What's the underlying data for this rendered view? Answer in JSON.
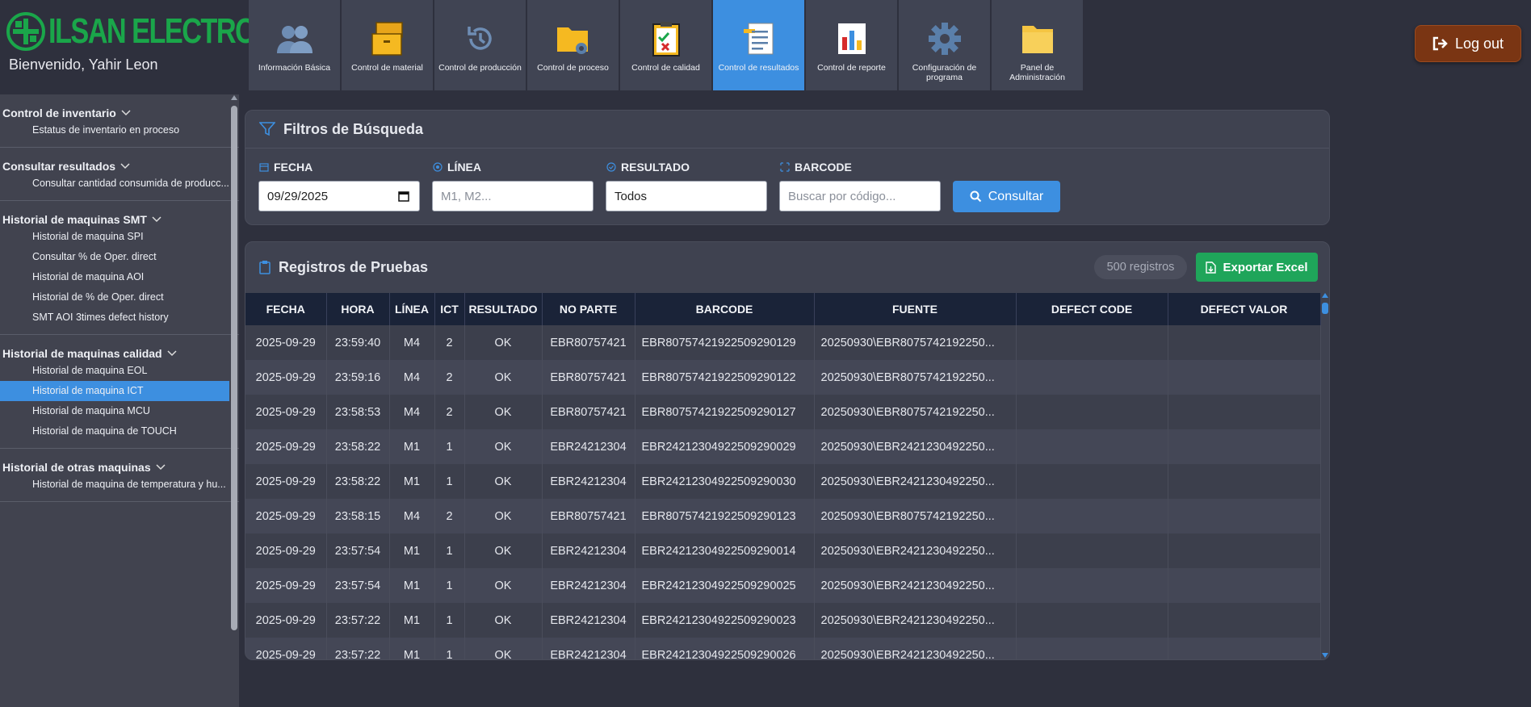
{
  "brand": {
    "name": "ILSAN ELECTRONICS",
    "welcome": "Bienvenido, Yahir Leon"
  },
  "nav": [
    {
      "label": "Información Básica",
      "icon": "users-icon"
    },
    {
      "label": "Control de material",
      "icon": "boxes-icon"
    },
    {
      "label": "Control de producción",
      "icon": "history-icon"
    },
    {
      "label": "Control de proceso",
      "icon": "folder-gear-icon"
    },
    {
      "label": "Control de calidad",
      "icon": "clipboard-check-icon"
    },
    {
      "label": "Control de resultados",
      "icon": "document-icon",
      "active": true
    },
    {
      "label": "Control de reporte",
      "icon": "report-chart-icon"
    },
    {
      "label": "Configuración de programa",
      "icon": "gear-icon"
    },
    {
      "label": "Panel de Administración",
      "icon": "folder-icon"
    }
  ],
  "logout_label": "Log out",
  "sidebar": [
    {
      "title": "Control de inventario",
      "items": [
        "Estatus de inventario en proceso"
      ]
    },
    {
      "title": "Consultar resultados",
      "items": [
        "Consultar cantidad consumida de producc..."
      ]
    },
    {
      "title": "Historial de maquinas SMT",
      "items": [
        "Historial de maquina SPI",
        "Consultar % de Oper. direct",
        "Historial de maquina AOI",
        "Historial de % de Oper. direct",
        "SMT AOI 3times defect history"
      ]
    },
    {
      "title": "Historial de maquinas calidad",
      "items": [
        "Historial de maquina EOL",
        "Historial de maquina ICT",
        "Historial de maquina MCU",
        "Historial de maquina de TOUCH"
      ],
      "active_item": "Historial de maquina ICT"
    },
    {
      "title": "Historial de otras maquinas",
      "items": [
        "Historial de maquina de temperatura y hu..."
      ]
    }
  ],
  "filters": {
    "title": "Filtros de Búsqueda",
    "fecha": {
      "label": "FECHA",
      "value": "09/29/2025"
    },
    "linea": {
      "label": "LÍNEA",
      "placeholder": "M1, M2..."
    },
    "resultado": {
      "label": "RESULTADO",
      "value": "Todos"
    },
    "barcode": {
      "label": "BARCODE",
      "placeholder": "Buscar por código..."
    },
    "consultar_label": "Consultar"
  },
  "records": {
    "title": "Registros de Pruebas",
    "count": "500 registros",
    "export_label": "Exportar Excel",
    "columns": [
      "FECHA",
      "HORA",
      "LÍNEA",
      "ICT",
      "RESULTADO",
      "NO PARTE",
      "BARCODE",
      "FUENTE",
      "DEFECT CODE",
      "DEFECT VALOR"
    ],
    "rows": [
      [
        "2025-09-29",
        "23:59:40",
        "M4",
        "2",
        "OK",
        "EBR80757421",
        "EBR80757421922509290129",
        "20250930\\EBR8075742192250...",
        "",
        ""
      ],
      [
        "2025-09-29",
        "23:59:16",
        "M4",
        "2",
        "OK",
        "EBR80757421",
        "EBR80757421922509290122",
        "20250930\\EBR8075742192250...",
        "",
        ""
      ],
      [
        "2025-09-29",
        "23:58:53",
        "M4",
        "2",
        "OK",
        "EBR80757421",
        "EBR80757421922509290127",
        "20250930\\EBR8075742192250...",
        "",
        ""
      ],
      [
        "2025-09-29",
        "23:58:22",
        "M1",
        "1",
        "OK",
        "EBR24212304",
        "EBR24212304922509290029",
        "20250930\\EBR2421230492250...",
        "",
        ""
      ],
      [
        "2025-09-29",
        "23:58:22",
        "M1",
        "1",
        "OK",
        "EBR24212304",
        "EBR24212304922509290030",
        "20250930\\EBR2421230492250...",
        "",
        ""
      ],
      [
        "2025-09-29",
        "23:58:15",
        "M4",
        "2",
        "OK",
        "EBR80757421",
        "EBR80757421922509290123",
        "20250930\\EBR8075742192250...",
        "",
        ""
      ],
      [
        "2025-09-29",
        "23:57:54",
        "M1",
        "1",
        "OK",
        "EBR24212304",
        "EBR24212304922509290014",
        "20250930\\EBR2421230492250...",
        "",
        ""
      ],
      [
        "2025-09-29",
        "23:57:54",
        "M1",
        "1",
        "OK",
        "EBR24212304",
        "EBR24212304922509290025",
        "20250930\\EBR2421230492250...",
        "",
        ""
      ],
      [
        "2025-09-29",
        "23:57:22",
        "M1",
        "1",
        "OK",
        "EBR24212304",
        "EBR24212304922509290023",
        "20250930\\EBR2421230492250...",
        "",
        ""
      ],
      [
        "2025-09-29",
        "23:57:22",
        "M1",
        "1",
        "OK",
        "EBR24212304",
        "EBR24212304922509290026",
        "20250930\\EBR2421230492250...",
        "",
        ""
      ]
    ]
  }
}
